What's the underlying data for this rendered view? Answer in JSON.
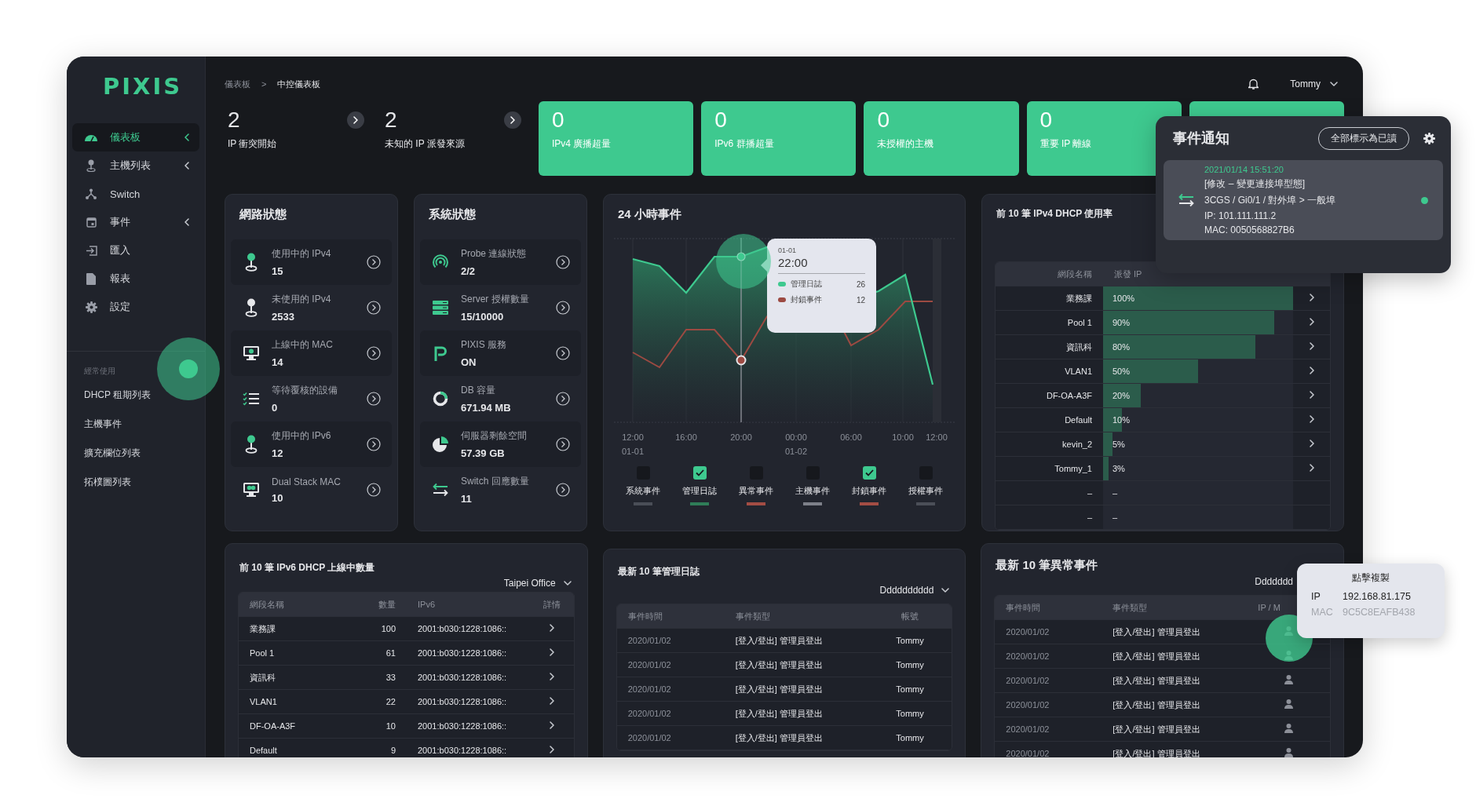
{
  "sidebar": {
    "logo": "PIXIS",
    "items": [
      {
        "label": "儀表板",
        "kind": "gauge",
        "selected": true,
        "submenu": true
      },
      {
        "label": "主機列表",
        "kind": "pin",
        "selected": false,
        "submenu": true
      },
      {
        "label": "Switch",
        "kind": "switch",
        "selected": false,
        "submenu": false
      },
      {
        "label": "事件",
        "kind": "calendar",
        "selected": false,
        "submenu": true
      },
      {
        "label": "匯入",
        "kind": "import",
        "selected": false,
        "submenu": false
      },
      {
        "label": "報表",
        "kind": "file",
        "selected": false,
        "submenu": false
      },
      {
        "label": "設定",
        "kind": "gear",
        "selected": false,
        "submenu": false
      }
    ],
    "section_title": "經常使用",
    "links": [
      "DHCP 租期列表",
      "主機事件",
      "擴充欄位列表",
      "拓樸圖列表"
    ]
  },
  "breadcrumb": {
    "items": [
      "儀表板",
      "中控儀表板"
    ],
    "separator": ">"
  },
  "user": {
    "name": "Tommy"
  },
  "stats": [
    {
      "kind": "plain",
      "value": "2",
      "label": "IP 衝突開始"
    },
    {
      "kind": "plain",
      "value": "2",
      "label": "未知的 IP 派發來源"
    },
    {
      "kind": "alert",
      "value": "0",
      "label": "IPv4 廣播超量"
    },
    {
      "kind": "alert",
      "value": "0",
      "label": "IPv6 群播超量"
    },
    {
      "kind": "alert",
      "value": "0",
      "label": "未授權的主機"
    },
    {
      "kind": "alert",
      "value": "0",
      "label": "重要 IP 離線"
    },
    {
      "kind": "alert"
    }
  ],
  "network_status": {
    "title": "網路狀態",
    "items": [
      {
        "kind": "pin-active",
        "label": "使用中的 IPv4",
        "value": "15"
      },
      {
        "kind": "pin-idle",
        "label": "未使用的 IPv4",
        "value": "2533"
      },
      {
        "kind": "monitor",
        "label": "上線中的 MAC",
        "value": "14"
      },
      {
        "kind": "checklist",
        "label": "等待覆核的設備",
        "value": "0"
      },
      {
        "kind": "pin-active",
        "label": "使用中的 IPv6",
        "value": "12"
      },
      {
        "kind": "monitor-dual",
        "label": "Dual Stack MAC",
        "value": "10"
      }
    ]
  },
  "system_status": {
    "title": "系統狀態",
    "items": [
      {
        "kind": "probe",
        "label": "Probe 連線狀態",
        "value": "2/2"
      },
      {
        "kind": "server",
        "label": "Server 授權數量",
        "value": "15/10000"
      },
      {
        "kind": "logo-p",
        "label": "PIXIS 服務",
        "value": "ON"
      },
      {
        "kind": "ring",
        "label": "DB 容量",
        "value": "671.94 MB"
      },
      {
        "kind": "pie",
        "label": "伺服器剩餘空間",
        "value": "57.39 GB"
      },
      {
        "kind": "swap",
        "label": "Switch 回應數量",
        "value": "11"
      }
    ]
  },
  "events_chart": {
    "title": "24 小時事件",
    "x_labels": [
      {
        "time": "12:00",
        "date": "01-01"
      },
      {
        "time": "16:00"
      },
      {
        "time": "20:00"
      },
      {
        "time": "00:00",
        "date": "01-02"
      },
      {
        "time": "06:00"
      },
      {
        "time": "10:00"
      },
      {
        "time": "12:00"
      }
    ],
    "tooltip": {
      "date": "01-01",
      "time": "22:00",
      "series": [
        {
          "name": "管理日誌",
          "value": "26",
          "color": "#3ec98f"
        },
        {
          "name": "封鎖事件",
          "value": "12",
          "color": "#9c4a42"
        }
      ]
    },
    "legend": [
      {
        "label": "系統事件",
        "checked": false,
        "color": "#4a4e57"
      },
      {
        "label": "管理日誌",
        "checked": true,
        "color": "#2f7d58"
      },
      {
        "label": "異常事件",
        "checked": false,
        "color": "#a34d44"
      },
      {
        "label": "主機事件",
        "checked": false,
        "color": "#7d8089"
      },
      {
        "label": "封鎖事件",
        "checked": true,
        "color": "#a34d44"
      },
      {
        "label": "授權事件",
        "checked": false,
        "color": "#4b4f58"
      }
    ]
  },
  "dhcp_usage": {
    "title": "前 10 筆 IPv4 DHCP 使用率",
    "columns": [
      "網段名稱",
      "派發 IP"
    ],
    "rows": [
      {
        "name": "業務課",
        "percent": "100%",
        "level": 1
      },
      {
        "name": "Pool 1",
        "percent": "90%",
        "level": 0.9
      },
      {
        "name": "資訊科",
        "percent": "80%",
        "level": 0.8
      },
      {
        "name": "VLAN1",
        "percent": "50%",
        "level": 0.5
      },
      {
        "name": "DF-OA-A3F",
        "percent": "20%",
        "level": 0.2
      },
      {
        "name": "Default",
        "percent": "10%",
        "level": 0.1
      },
      {
        "name": "kevin_2",
        "percent": "5%",
        "level": 0.05
      },
      {
        "name": "Tommy_1",
        "percent": "3%",
        "level": 0.03
      },
      {
        "name": "–",
        "percent": "–"
      },
      {
        "name": "–",
        "percent": "–"
      }
    ]
  },
  "ipv6_dhcp": {
    "title": "前 10 筆 IPv6 DHCP 上線中數量",
    "filter": "Taipei Office",
    "columns": [
      "網段名稱",
      "數量",
      "IPv6",
      "詳情"
    ],
    "rows": [
      {
        "name": "業務課",
        "count": "100",
        "ipv6": "2001:b030:1228:1086::"
      },
      {
        "name": "Pool 1",
        "count": "61",
        "ipv6": "2001:b030:1228:1086::"
      },
      {
        "name": "資訊科",
        "count": "33",
        "ipv6": "2001:b030:1228:1086::"
      },
      {
        "name": "VLAN1",
        "count": "22",
        "ipv6": "2001:b030:1228:1086::"
      },
      {
        "name": "DF-OA-A3F",
        "count": "10",
        "ipv6": "2001:b030:1228:1086::"
      },
      {
        "name": "Default",
        "count": "9",
        "ipv6": "2001:b030:1228:1086::"
      }
    ]
  },
  "admin_log": {
    "title": "最新 10 筆管理日誌",
    "filter": "Dddddddddd",
    "columns": [
      "事件時間",
      "事件類型",
      "帳號"
    ],
    "rows": [
      {
        "time": "2020/01/02",
        "type": "[登入/登出] 管理員登出",
        "account": "Tommy"
      },
      {
        "time": "2020/01/02",
        "type": "[登入/登出] 管理員登出",
        "account": "Tommy"
      },
      {
        "time": "2020/01/02",
        "type": "[登入/登出] 管理員登出",
        "account": "Tommy"
      },
      {
        "time": "2020/01/02",
        "type": "[登入/登出] 管理員登出",
        "account": "Tommy"
      },
      {
        "time": "2020/01/02",
        "type": "[登入/登出] 管理員登出",
        "account": "Tommy"
      }
    ]
  },
  "anomaly_events": {
    "title": "最新 10 筆異常事件",
    "filter": "Ddddddd",
    "columns": [
      "事件時間",
      "事件類型",
      "IP / M"
    ],
    "rows": [
      {
        "time": "2020/01/02",
        "type": "[登入/登出] 管理員登出"
      },
      {
        "time": "2020/01/02",
        "type": "[登入/登出] 管理員登出"
      },
      {
        "time": "2020/01/02",
        "type": "[登入/登出] 管理員登出"
      },
      {
        "time": "2020/01/02",
        "type": "[登入/登出] 管理員登出"
      },
      {
        "time": "2020/01/02",
        "type": "[登入/登出] 管理員登出"
      },
      {
        "time": "2020/01/02",
        "type": "[登入/登出] 管理員登出"
      }
    ]
  },
  "notification": {
    "title": "事件通知",
    "action": "全部標示為已讀",
    "items": [
      {
        "time": "2021/01/14 15:51:20",
        "lines": [
          "[修改 – 變更連接埠型態]",
          "3CGS / Gi0/1 / 對外埠 > 一般埠",
          "IP: 101.111.111.2",
          "MAC: 0050568827B6"
        ],
        "unread": true
      }
    ]
  },
  "copy_tooltip": {
    "title": "點擊複製",
    "rows": [
      {
        "label": "IP",
        "value": "192.168.81.175",
        "selected": true
      },
      {
        "label": "MAC",
        "value": "9C5C8EAFB438",
        "selected": false
      }
    ]
  }
}
